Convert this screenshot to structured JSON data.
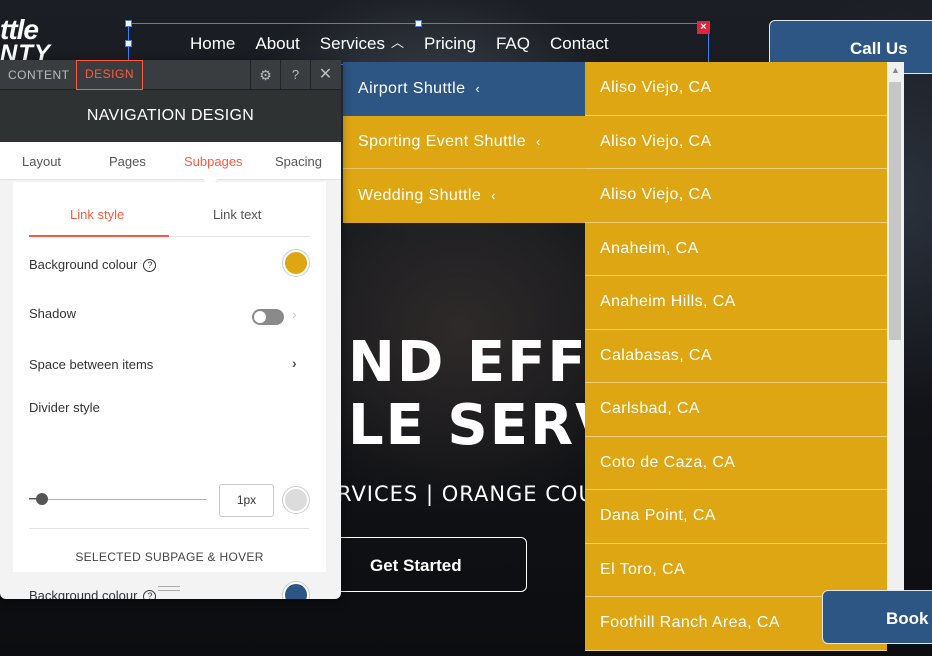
{
  "site": {
    "logo_line1": "ttle",
    "logo_line2": "NTY",
    "nav": [
      "Home",
      "About",
      "Services",
      "Pricing",
      "FAQ",
      "Contact"
    ],
    "call_button": "Call Us",
    "book_button": "Book",
    "hero_line1": "ND EFFIC",
    "hero_line2": "LE SERV",
    "hero_sub": "RVICES | ORANGE COU",
    "get_started": "Get Started"
  },
  "submenu": {
    "items": [
      {
        "label": "Airport Shuttle",
        "active": true
      },
      {
        "label": "Sporting Event Shuttle",
        "active": false
      },
      {
        "label": "Wedding Shuttle",
        "active": false
      }
    ],
    "chevron": "‹"
  },
  "cities": [
    "Aliso Viejo, CA",
    "Aliso Viejo, CA",
    "Aliso Viejo, CA",
    "Anaheim, CA",
    "Anaheim Hills, CA",
    "Calabasas, CA",
    "Carlsbad, CA",
    "Coto de Caza, CA",
    "Dana Point, CA",
    "El Toro, CA",
    "Foothill Ranch Area, CA"
  ],
  "panel": {
    "tab_content": "CONTENT",
    "tab_design": "DESIGN",
    "title": "NAVIGATION DESIGN",
    "subtabs": [
      "Layout",
      "Pages",
      "Subpages",
      "Spacing"
    ],
    "link_tabs": [
      "Link style",
      "Link text"
    ],
    "bg_colour_label": "Background colour",
    "shadow_label": "Shadow",
    "space_label": "Space between items",
    "divider_label": "Divider style",
    "divider_value": "1px",
    "section_heading": "SELECTED SUBPAGE & HOVER",
    "hover_bg_label": "Background colour",
    "help": "?"
  },
  "colors": {
    "gold": "#dea612",
    "navy": "#2d5685",
    "accent": "#ff5a3d",
    "divider_swatch": "#dcdcdc",
    "hover_swatch": "#2d5685"
  }
}
